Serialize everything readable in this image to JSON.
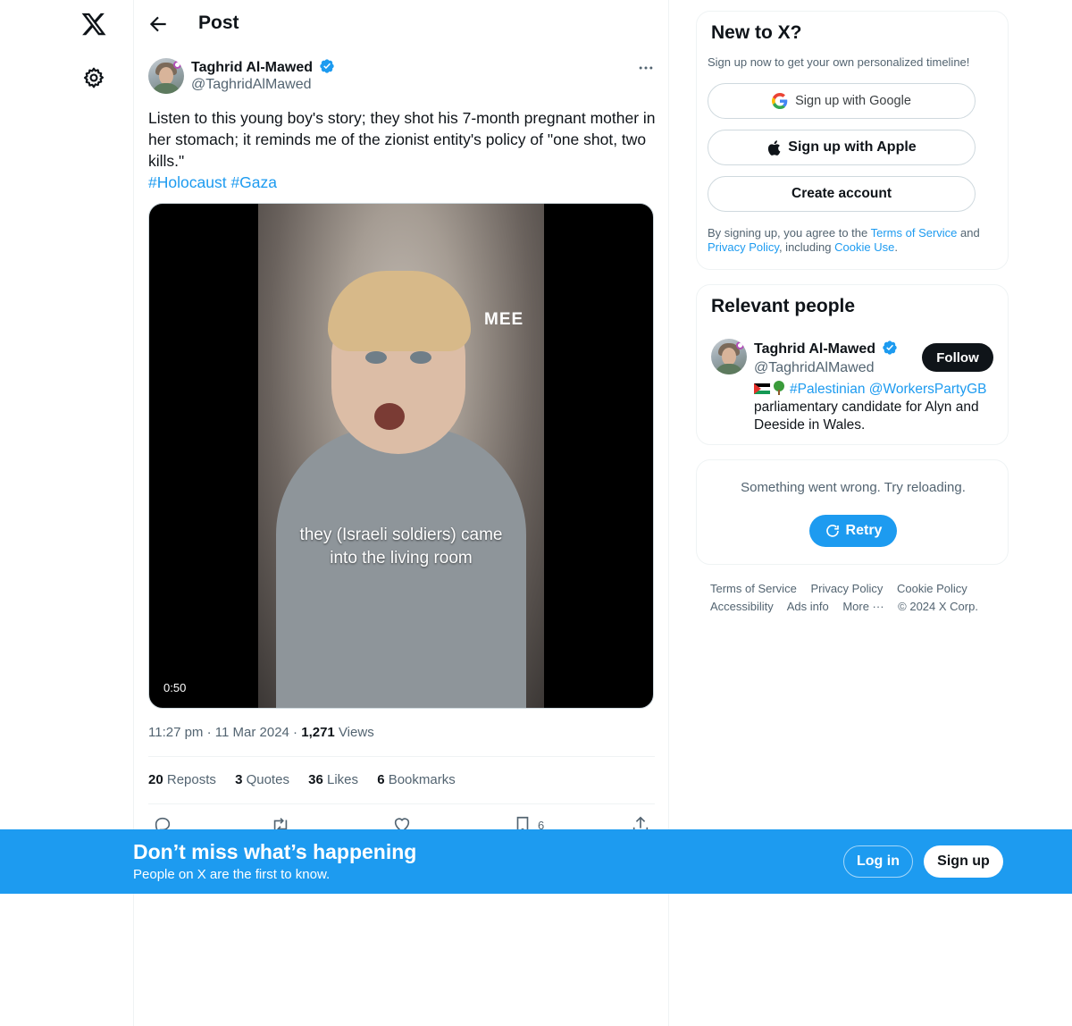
{
  "nav": {
    "logo_icon": "x-logo-icon",
    "settings_icon": "gear-icon"
  },
  "header": {
    "title": "Post"
  },
  "post": {
    "author_name": "Taghrid Al-Mawed",
    "author_handle": "@TaghridAlMawed",
    "text": "Listen to this young boy's story; they shot his 7-month pregnant mother in her stomach; it reminds me of the zionist entity's policy of \"one shot, two kills.\"",
    "hashtags": [
      "#Holocaust",
      "#Gaza"
    ],
    "video": {
      "watermark": "MEE",
      "subtitle_line1": "they (Israeli soldiers) came",
      "subtitle_line2": "into the living room",
      "duration": "0:50"
    },
    "time": "11:27 pm",
    "date": "11 Mar 2024",
    "views_count": "1,271",
    "views_label": "Views",
    "stats": [
      {
        "count": "20",
        "label": "Reposts"
      },
      {
        "count": "3",
        "label": "Quotes"
      },
      {
        "count": "36",
        "label": "Likes"
      },
      {
        "count": "6",
        "label": "Bookmarks"
      }
    ],
    "bookmark_count": "6"
  },
  "signup_card": {
    "title": "New to X?",
    "subtitle": "Sign up now to get your own personalized timeline!",
    "google_label": "Sign up with Google",
    "apple_label": "Sign up with Apple",
    "create_label": "Create account",
    "legal_prefix": "By signing up, you agree to the ",
    "terms": "Terms of Service",
    "and": " and",
    "privacy": "Privacy Policy",
    "including": ", including ",
    "cookie": "Cookie Use",
    "period": "."
  },
  "relevant": {
    "title": "Relevant people",
    "name": "Taghrid Al-Mawed",
    "handle": "@TaghridAlMawed",
    "follow_label": "Follow",
    "bio_link1": "#Palestinian",
    "bio_link2": "@WorkersPartyGB",
    "bio_rest": "parliamentary candidate for Alyn and Deeside in Wales."
  },
  "error_card": {
    "message": "Something went wrong. Try reloading.",
    "retry_label": "Retry"
  },
  "footer": {
    "links": [
      "Terms of Service",
      "Privacy Policy",
      "Cookie Policy",
      "Accessibility",
      "Ads info",
      "More ···",
      "© 2024 X Corp."
    ]
  },
  "banner": {
    "title": "Don’t miss what’s happening",
    "subtitle": "People on X are the first to know.",
    "login_label": "Log in",
    "signup_label": "Sign up"
  },
  "colors": {
    "accent": "#1d9bf0",
    "text": "#0f1419",
    "secondary": "#536471"
  }
}
